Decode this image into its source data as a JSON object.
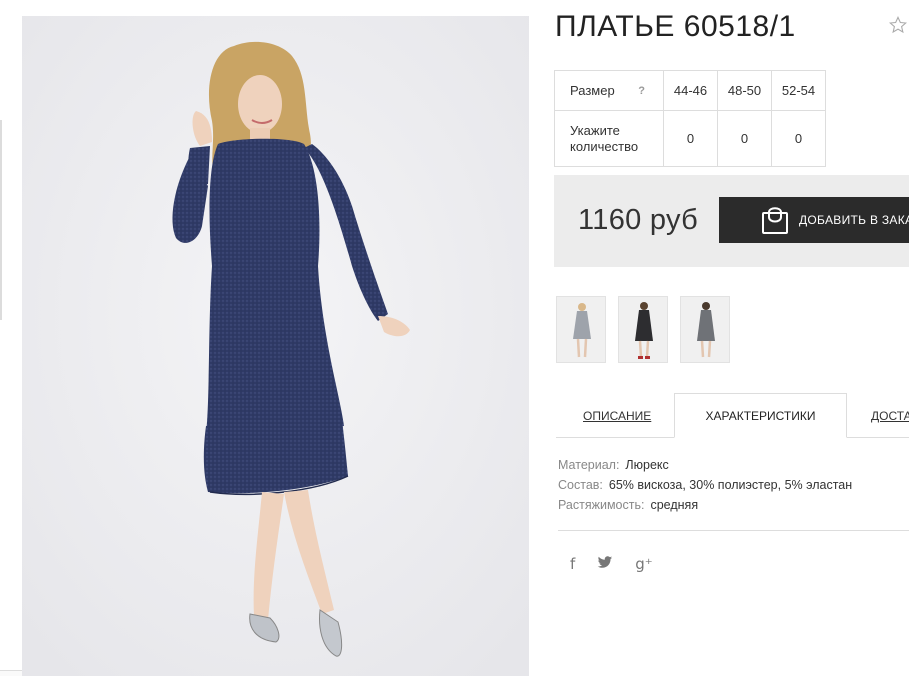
{
  "product": {
    "title": "ПЛАТЬЕ 60518/1"
  },
  "sizes": {
    "size_label": "Размер",
    "help": "?",
    "qty_label": "Укажите количество",
    "columns": [
      {
        "size": "44-46",
        "qty": "0"
      },
      {
        "size": "48-50",
        "qty": "0"
      },
      {
        "size": "52-54",
        "qty": "0"
      }
    ]
  },
  "price": {
    "value": "1160 руб",
    "button_label": "ДОБАВИТЬ В ЗАКАЗ"
  },
  "thumbnails": [
    {
      "name": "light-grey-dress"
    },
    {
      "name": "black-dress"
    },
    {
      "name": "grey-dress"
    }
  ],
  "tabs": [
    {
      "label": "ОПИСАНИЕ",
      "active": false
    },
    {
      "label": "ХАРАКТЕРИСТИКИ",
      "active": true
    },
    {
      "label": "ДОСТАВКА",
      "active": false
    }
  ],
  "specs": [
    {
      "key": "Материал:",
      "value": "Люрекс"
    },
    {
      "key": "Состав:",
      "value": "65% вискоза, 30% полиэстер, 5% эластан"
    },
    {
      "key": "Растяжимость:",
      "value": "средняя"
    }
  ],
  "social": {
    "facebook": "f",
    "twitter": "🐦",
    "googleplus": "g⁺"
  },
  "colors": {
    "dress": "#2f3a66",
    "button": "#2b2b2b",
    "price_bg": "#ececec"
  }
}
